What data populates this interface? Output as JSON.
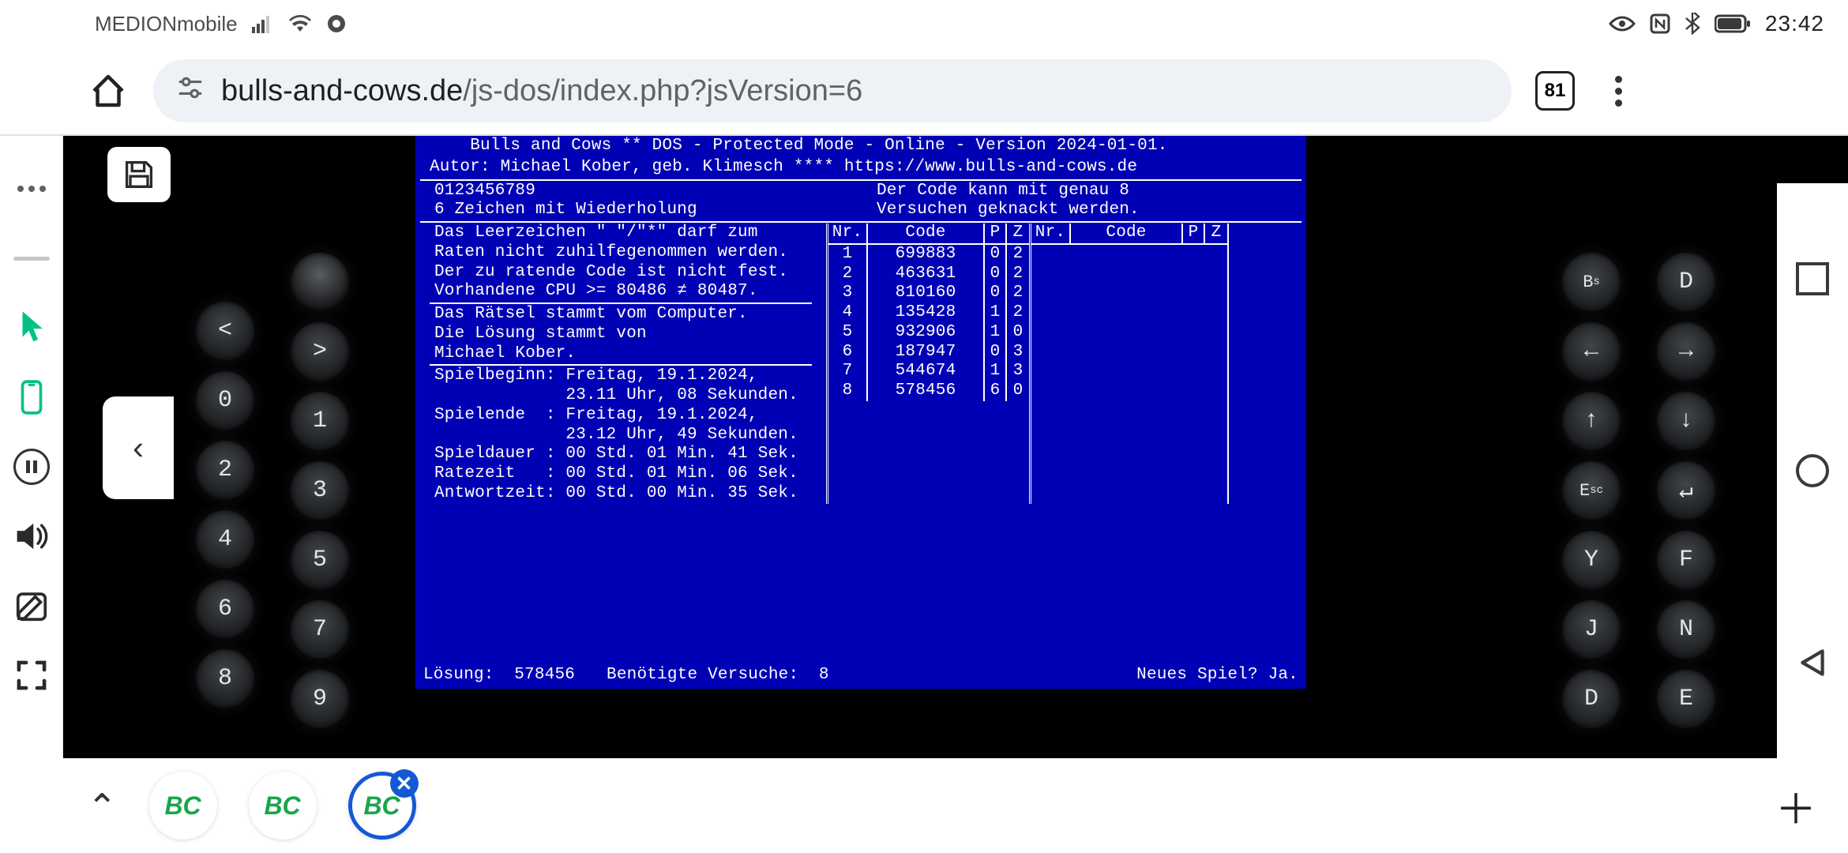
{
  "status_bar": {
    "carrier": "MEDIONmobile",
    "time": "23:42"
  },
  "browser": {
    "url_host": "bulls-and-cows.de",
    "url_path": "/js-dos/index.php?jsVersion=6",
    "tab_count": "81"
  },
  "left_keypad_a": [
    "<",
    "0",
    "2",
    "4",
    "6",
    "8"
  ],
  "left_keypad_b": [
    "",
    ">",
    "1",
    "3",
    "5",
    "7",
    "9"
  ],
  "right_keypad_c": [
    "Bₛ",
    "←",
    "↑",
    "Eₛc",
    "Y",
    "J",
    "D"
  ],
  "right_keypad_d": [
    "D",
    "→",
    "↓",
    "↵",
    "F",
    "N",
    "E"
  ],
  "dos": {
    "title1": "Bulls and Cows ** DOS - Protected Mode - Online - Version 2024-01-01.",
    "title2": "Autor: Michael Kober, geb. Klimesch   ****   https://www.bulls-and-cows.de",
    "digits": "0123456789",
    "rule": "6 Zeichen mit Wiederholung",
    "hint1": "Der Code kann mit genau 8",
    "hint2": "Versuchen geknackt werden.",
    "info": [
      "Das Leerzeichen \" \"/\"*\" darf zum",
      "Raten nicht zuhilfegenommen werden.",
      "Der zu ratende Code ist nicht fest.",
      "Vorhandene CPU >= 80486 ≠ 80487.",
      "",
      "Das Rätsel stammt vom Computer.",
      "",
      "Die Lösung stammt von",
      "Michael Kober.",
      "",
      "Spielbeginn: Freitag, 19.1.2024,",
      "             23.11 Uhr, 08 Sekunden.",
      "Spielende  : Freitag, 19.1.2024,",
      "             23.12 Uhr, 49 Sekunden.",
      "Spieldauer : 00 Std. 01 Min. 41 Sek.",
      "Ratezeit   : 00 Std. 01 Min. 06 Sek.",
      "Antwortzeit: 00 Std. 00 Min. 35 Sek."
    ],
    "th_nr": "Nr.",
    "th_code": "Code",
    "th_p": "P",
    "th_z": "Z",
    "guesses": [
      {
        "nr": "1",
        "code": "699883",
        "p": "0",
        "z": "2"
      },
      {
        "nr": "2",
        "code": "463631",
        "p": "0",
        "z": "2"
      },
      {
        "nr": "3",
        "code": "810160",
        "p": "0",
        "z": "2"
      },
      {
        "nr": "4",
        "code": "135428",
        "p": "1",
        "z": "2"
      },
      {
        "nr": "5",
        "code": "932906",
        "p": "1",
        "z": "0"
      },
      {
        "nr": "6",
        "code": "187947",
        "p": "0",
        "z": "3"
      },
      {
        "nr": "7",
        "code": "544674",
        "p": "1",
        "z": "3"
      },
      {
        "nr": "8",
        "code": "578456",
        "p": "6",
        "z": "0"
      }
    ],
    "footer_solution_label": "Lösung:",
    "footer_solution": "578456",
    "footer_tries_label": "Benötigte Versuche:",
    "footer_tries": "8",
    "footer_newgame": "Neues Spiel? Ja."
  },
  "bottom_tabs": {
    "label": "BC"
  }
}
